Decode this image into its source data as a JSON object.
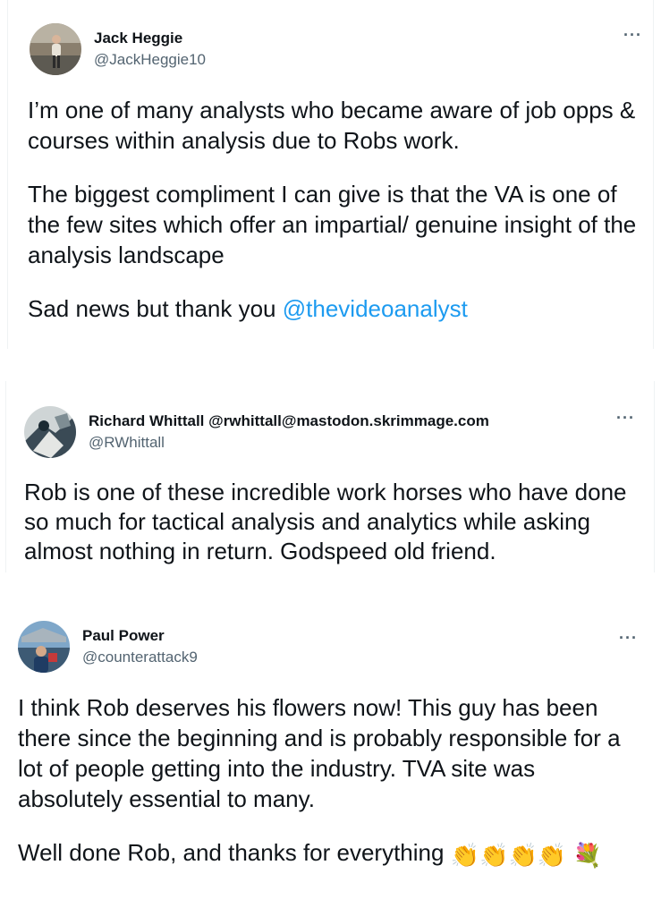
{
  "tweets": [
    {
      "display_name": "Jack Heggie",
      "handle": "@JackHeggie10",
      "more_label": "···",
      "avatar_icon": "person-photo-avatar",
      "paragraphs": [
        "I’m one of many analysts who became aware of job opps & courses within analysis due to Robs work.",
        "The biggest compliment I can give is that the VA is one of the few sites which offer an impartial/ genuine insight of the analysis landscape"
      ],
      "last_text": "Sad news but thank you ",
      "mention": "@thevideoanalyst"
    },
    {
      "display_name": "Richard Whittall @rwhittall@mastodon.skrimmage.com",
      "handle": "@RWhittall",
      "more_label": "···",
      "avatar_icon": "illustration-avatar",
      "paragraphs": [
        "Rob is one of these incredible work horses who have done so much for tactical analysis and analytics while asking almost nothing in return. Godspeed old friend."
      ]
    },
    {
      "display_name": "Paul Power",
      "handle": "@counterattack9",
      "more_label": "···",
      "avatar_icon": "stadium-photo-avatar",
      "paragraphs": [
        "I think Rob deserves his flowers now! This guy has been there since the beginning and is probably responsible for a lot of people getting into the industry. TVA site was absolutely essential to many."
      ],
      "last_text": "Well done Rob, and thanks for everything ",
      "emojis": [
        "👏",
        "👏",
        "👏",
        "👏",
        "💐"
      ]
    }
  ],
  "colors": {
    "text": "#0f1419",
    "secondary": "#536471",
    "link": "#1d9bf0"
  }
}
